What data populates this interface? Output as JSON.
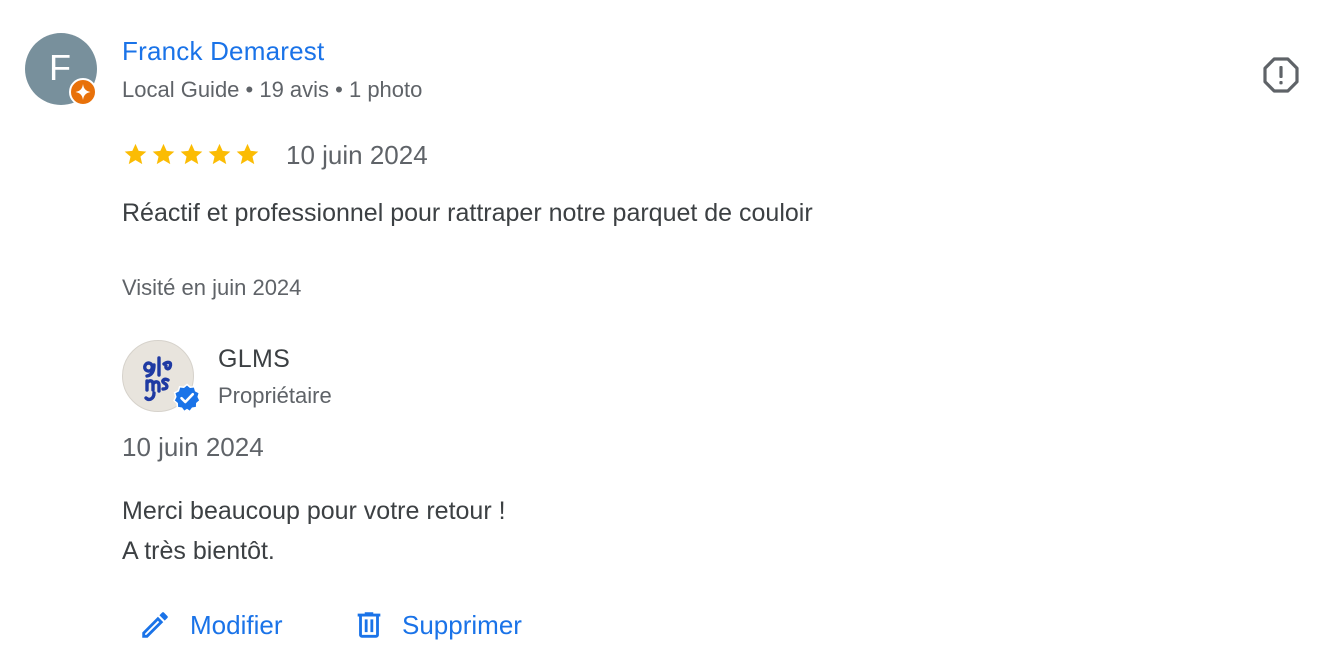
{
  "review": {
    "reviewer": {
      "initial": "F",
      "name": "Franck Demarest",
      "meta": "Local Guide • 19 avis • 1 photo",
      "avatar_color": "#78909c",
      "badge_icon": "local-guide-star-icon",
      "badge_color": "#e8710a"
    },
    "rating": 5,
    "max_rating": 5,
    "star_color": "#fbbc04",
    "date": "10 juin 2024",
    "text": "Réactif et professionnel pour rattraper notre parquet de couloir",
    "visited": "Visité en juin 2024",
    "report_icon": "report-icon"
  },
  "owner_response": {
    "name": "GLMS",
    "role": "Propriétaire",
    "verified_icon": "verified-check-icon",
    "verified_color": "#1a73e8",
    "date": "10 juin 2024",
    "lines": [
      "Merci beaucoup pour votre retour !",
      "A très bientôt."
    ]
  },
  "actions": {
    "edit_label": "Modifier",
    "edit_icon": "pencil-icon",
    "delete_label": "Supprimer",
    "delete_icon": "trash-icon"
  },
  "colors": {
    "link": "#1a73e8",
    "text": "#3c4043",
    "secondary_text": "#5f6368"
  }
}
